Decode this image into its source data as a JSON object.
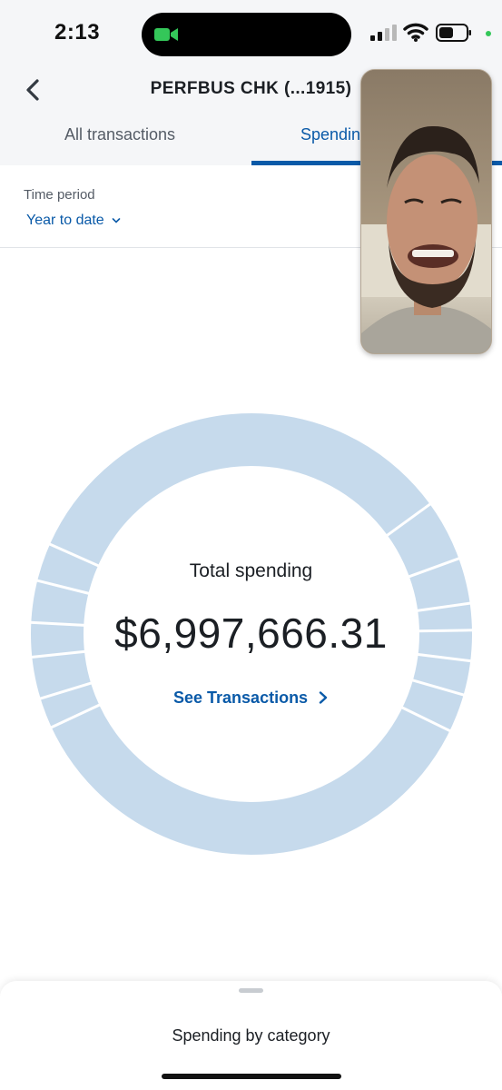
{
  "status_bar": {
    "time": "2:13",
    "icons": [
      "facetime-camera-icon",
      "cellular-signal-icon",
      "wifi-icon",
      "battery-icon",
      "camera-in-use-indicator"
    ]
  },
  "header": {
    "title": "PERFBUS CHK  (...1915)",
    "back_icon": "chevron-left-icon",
    "tabs": [
      {
        "label": "All transactions",
        "active": false
      },
      {
        "label": "Spendin",
        "active": true
      }
    ]
  },
  "filter": {
    "label": "Time period",
    "value": "Year to date"
  },
  "summary": {
    "label": "Total spending",
    "amount": "$6,997,666.31",
    "link": "See Transactions"
  },
  "bottom_sheet": {
    "title": "Spending by category"
  },
  "colors": {
    "accent": "#0a5aa8",
    "donut_fill": "#c6daec",
    "header_bg": "#f5f6f8"
  }
}
